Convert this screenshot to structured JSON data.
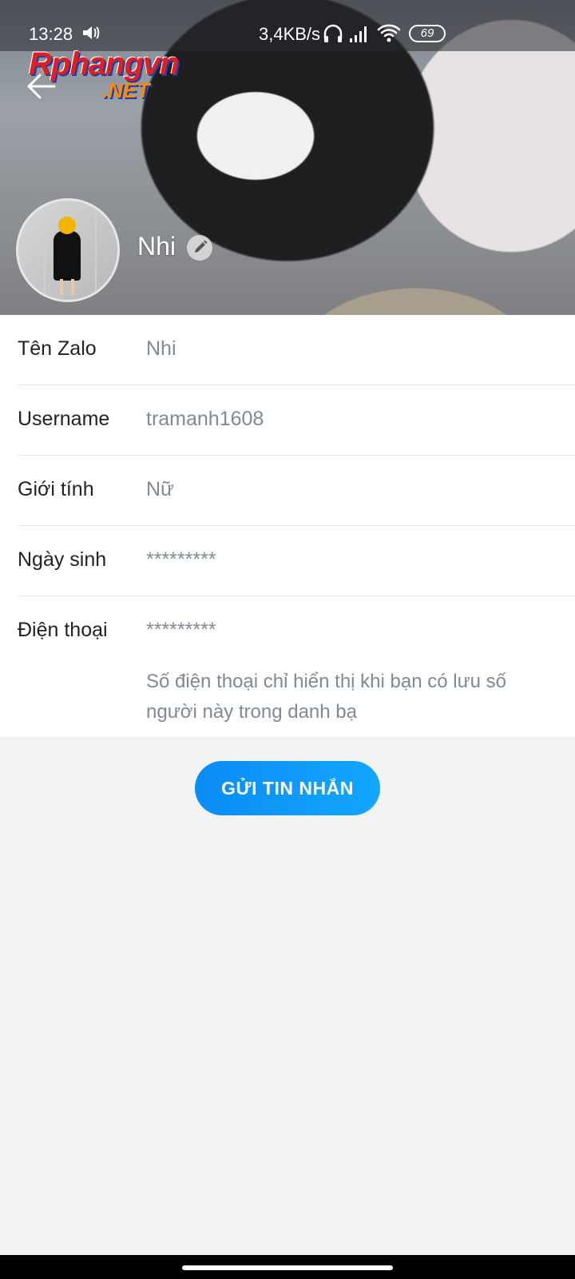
{
  "status_bar": {
    "time": "13:28",
    "network_speed": "3,4KB/s",
    "battery": "69",
    "icons": [
      "volume-icon",
      "headphones-icon",
      "signal-icon",
      "wifi-icon",
      "battery-icon"
    ]
  },
  "header": {
    "back_icon": "arrow-left-icon",
    "watermark_line1": "Rphangvn",
    "watermark_line2": ".NET",
    "profile_name": "Nhi",
    "edit_icon": "pencil-icon"
  },
  "info": {
    "rows": [
      {
        "label": "Tên Zalo",
        "value": "Nhi"
      },
      {
        "label": "Username",
        "value": "tramanh1608"
      },
      {
        "label": "Giới tính",
        "value": "Nữ"
      },
      {
        "label": "Ngày sinh",
        "value": "*********"
      },
      {
        "label": "Điện thoại",
        "value": "*********"
      }
    ],
    "phone_note": "Số điện thoại chỉ hiển thị khi bạn có lưu số người này trong danh bạ"
  },
  "actions": {
    "send_message_label": "GỬI TIN NHẮN"
  },
  "colors": {
    "accent": "#0a8cf5",
    "label_text": "#222222",
    "value_text": "#7f8a96",
    "page_background": "#f1f3f5"
  }
}
